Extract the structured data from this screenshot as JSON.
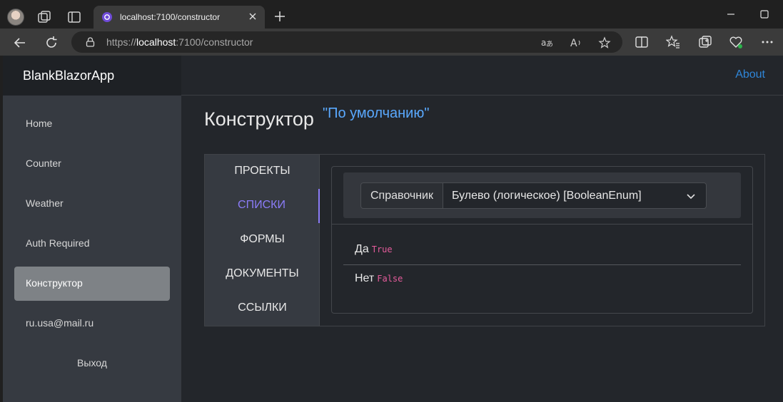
{
  "browser": {
    "tab_title": "localhost:7100/constructor",
    "url_scheme": "https://",
    "url_host": "localhost",
    "url_rest": ":7100/constructor"
  },
  "app": {
    "brand": "BlankBlazorApp",
    "about_link": "About",
    "nav": [
      {
        "label": "Home"
      },
      {
        "label": "Counter"
      },
      {
        "label": "Weather"
      },
      {
        "label": "Auth Required"
      },
      {
        "label": "Конструктор"
      },
      {
        "label": "ru.usa@mail.ru"
      },
      {
        "label": "Выход"
      }
    ],
    "active_nav": "Конструктор"
  },
  "main": {
    "title": "Конструктор",
    "subtitle": "\"По умолчанию\"",
    "tabs": [
      {
        "label": "ПРОЕКТЫ"
      },
      {
        "label": "СПИСКИ"
      },
      {
        "label": "ФОРМЫ"
      },
      {
        "label": "ДОКУМЕНТЫ"
      },
      {
        "label": "ССЫЛКИ"
      }
    ],
    "active_tab": "СПИСКИ",
    "directory": {
      "label": "Справочник",
      "selected": "Булево (логическое) [BooleanEnum]"
    },
    "items": [
      {
        "name": "Да",
        "code": "True"
      },
      {
        "name": "Нет",
        "code": "False"
      }
    ]
  },
  "colors": {
    "accent": "#8b7cf8",
    "link": "#2f86d8",
    "subtitle": "#5aa9ff",
    "code": "#e65c9c"
  }
}
